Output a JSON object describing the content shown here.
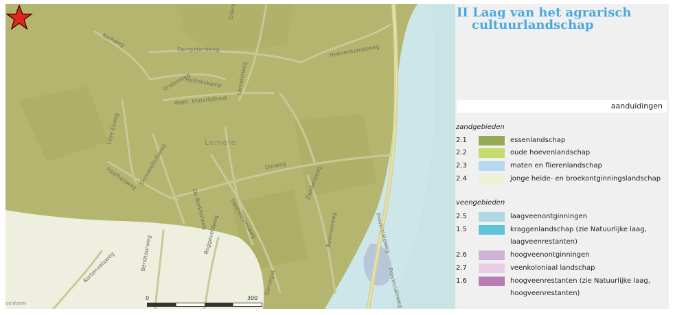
{
  "map": {
    "road_labels": [
      "Kerkweg",
      "Oderstraat",
      "Dempstersteeg",
      "Hoevenkampsweg",
      "Grotenweg",
      "Hallinkskamp",
      "Lemelerweg",
      "Weth. Immirkstraat",
      "Laye Esweg",
      "Raafhuisweg",
      "Dommelhofsweg",
      "Dorweg",
      "De Berkhofweg",
      "Haarsteumsweg",
      "Zandersteeg",
      "Provincialeweg",
      "Provincialeweg",
      "Roggeveldweg",
      "Bulenserweg",
      "Kortenvelaweg",
      "Benthaurweg",
      "Ganzegat"
    ],
    "town_label": "Lemele",
    "scale": {
      "start": "0",
      "end": "300 m"
    },
    "attribution": "oeldoom",
    "marker": "star-marker",
    "colors": {
      "land": "#b4b56e",
      "water": "#cde6ea",
      "bog": "#c9e4e6",
      "peat": "#b8c6da",
      "sand": "#efefe0",
      "marker": "#e2261c"
    }
  },
  "legend": {
    "title_line1": "II Laag van het agrarisch",
    "title_line2": "cultuurlandschap",
    "header": "aanduidingen",
    "groups": [
      {
        "title": "zandgebieden",
        "items": [
          {
            "code": "2.1",
            "label": "essenlandschap",
            "color": "#97ab57"
          },
          {
            "code": "2.2",
            "label": "oude hoevenlandschap",
            "color": "#c5dc6e"
          },
          {
            "code": "2.3",
            "label": "maten en flierenlandschap",
            "color": "#b6d9ef"
          },
          {
            "code": "2.4",
            "label": "jonge heide- en broekontginningslandschap",
            "color": "#eef1d2"
          }
        ]
      },
      {
        "title": "veengebieden",
        "items": [
          {
            "code": "2.5",
            "label": "laagveenontginningen",
            "color": "#add8e4"
          },
          {
            "code": "1.5",
            "label": "kraggenlandschap  (zie Natuurlijke laag,",
            "label2": "laagveenrestanten)",
            "color": "#60c4d8"
          },
          {
            "code": "2.6",
            "label": "hoogveenontginningen",
            "color": "#d1b2d7"
          },
          {
            "code": "2.7",
            "label": "veenkoloniaal landschap",
            "color": "#e9cde5"
          },
          {
            "code": "1.6",
            "label": "hoogveenrestanten (zie Natuurlijke laag,",
            "label2": "hoogveenrestanten)",
            "color": "#b87cb7"
          }
        ]
      }
    ]
  }
}
